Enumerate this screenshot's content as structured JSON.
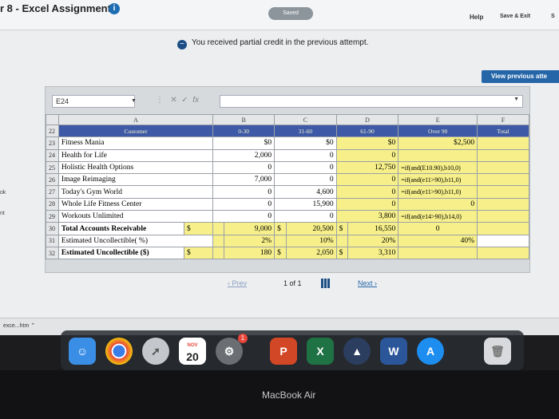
{
  "header": {
    "title": "r 8 - Excel Assignment",
    "saved_badge": "Saved",
    "help": "Help",
    "save_exit": "Save & Exit",
    "more_cut": "S"
  },
  "notice": {
    "text": "You received partial credit in the previous attempt."
  },
  "view_previous": "View previous atte",
  "left_stub": {
    "a": "ok",
    "b": "nt"
  },
  "excel": {
    "name_box": "E24",
    "column_headers": [
      "A",
      "B",
      "C",
      "D",
      "E",
      "F"
    ],
    "row_22": {
      "num": "22",
      "a": "Customer",
      "b": "0-30",
      "c": "31-60",
      "d": "61-90",
      "e": "Over 90",
      "f": "Total"
    },
    "rows": [
      {
        "num": "23",
        "a": "Fitness Mania",
        "b": "$0",
        "c": "$0",
        "d": "$0",
        "e": "$2,500"
      },
      {
        "num": "24",
        "a": "Health for Life",
        "b": "2,000",
        "c": "0",
        "d": "0",
        "e": ""
      },
      {
        "num": "25",
        "a": "Holistic Health Options",
        "b": "0",
        "c": "0",
        "d": "12,750",
        "e": "=if(and(E10.90),b10,0)"
      },
      {
        "num": "26",
        "a": "Image Reimaging",
        "b": "7,000",
        "c": "0",
        "d": "0",
        "e": "=if(and(e11>90),b11,0)"
      },
      {
        "num": "27",
        "a": "Today's Gym World",
        "b": "0",
        "c": "4,600",
        "d": "0",
        "e": "=if(and(e11>90),b11,0)"
      },
      {
        "num": "28",
        "a": "Whole Life Fitness Center",
        "b": "0",
        "c": "15,900",
        "d": "0",
        "e": "0"
      },
      {
        "num": "29",
        "a": "Workouts Unlimited",
        "b": "0",
        "c": "0",
        "d": "3,800",
        "e": "=if(and(e14>90),b14,0)"
      }
    ],
    "row_30": {
      "num": "30",
      "a": "Total Accounts Receivable",
      "dol_b": "$",
      "b": "9,000",
      "dol_c": "$",
      "c": "20,500",
      "dol_d": "$",
      "d": "16,550",
      "e": "0"
    },
    "row_31": {
      "num": "31",
      "a": "Estimated Uncollectible( %)",
      "b": "2%",
      "c": "10%",
      "d": "20%",
      "e": "40%"
    },
    "row_32": {
      "num": "32",
      "a": "Estimated Uncollectible ($)",
      "dol_a": "$",
      "b": "180",
      "dol_b": "$",
      "c": "2,050",
      "dol_c": "$",
      "d": "3,310"
    }
  },
  "pager": {
    "prev": "Prev",
    "info": "1 of 1",
    "next": "Next"
  },
  "downloads": {
    "file": "exce...htm"
  },
  "dock": {
    "calendar_month": "NOV",
    "calendar_day": "20",
    "badge": "1",
    "ppt": "P",
    "excel": "X",
    "word": "W"
  },
  "device_label": "MacBook Air"
}
